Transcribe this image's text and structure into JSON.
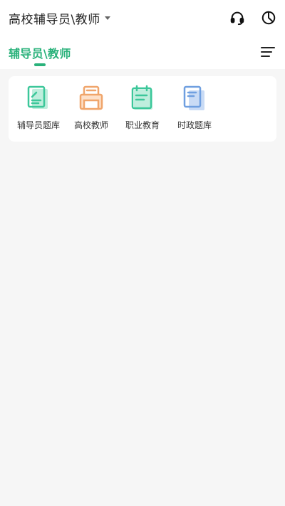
{
  "header": {
    "title": "高校辅导员\\教师",
    "support_icon": "headset-icon",
    "stats_icon": "pie-chart-icon"
  },
  "tabs": {
    "active_label": "辅导员\\教师",
    "menu_icon": "menu-icon",
    "accent_color": "#2ab27b"
  },
  "categories": [
    {
      "label": "辅导员题库",
      "icon": "document-icon",
      "color": "#3cc79a"
    },
    {
      "label": "高校教师",
      "icon": "printer-icon",
      "color": "#f0a56b"
    },
    {
      "label": "职业教育",
      "icon": "notepad-icon",
      "color": "#3cc79a"
    },
    {
      "label": "时政题库",
      "icon": "documents-icon",
      "color": "#6f9fe0"
    }
  ]
}
